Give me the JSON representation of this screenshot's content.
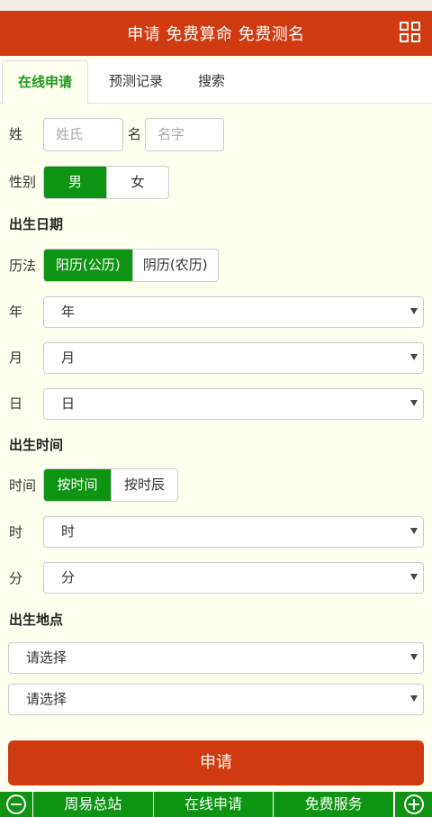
{
  "header": {
    "title": "申请 免费算命 免费测名"
  },
  "tabs": [
    {
      "label": "在线申请"
    },
    {
      "label": "预测记录"
    },
    {
      "label": "搜索"
    }
  ],
  "form": {
    "surname_label": "姓",
    "surname_placeholder": "姓氏",
    "name_label": "名",
    "name_placeholder": "名字",
    "gender_label": "性别",
    "gender_options": [
      "男",
      "女"
    ],
    "birth_date_section": "出生日期",
    "calendar_label": "历法",
    "calendar_options": [
      "阳历(公历)",
      "阴历(农历)"
    ],
    "year_label": "年",
    "year_value": "年",
    "month_label": "月",
    "month_value": "月",
    "day_label": "日",
    "day_value": "日",
    "birth_time_section": "出生时间",
    "time_label": "时间",
    "time_options": [
      "按时间",
      "按时辰"
    ],
    "hour_label": "时",
    "hour_value": "时",
    "minute_label": "分",
    "minute_value": "分",
    "birth_place_section": "出生地点",
    "province_value": "请选择",
    "city_value": "请选择",
    "submit_label": "申请"
  },
  "footer": {
    "items": [
      "周易总站",
      "在线申请",
      "免费服务"
    ]
  },
  "colors": {
    "brand_red": "#cf3a11",
    "brand_green": "#0e9412",
    "background": "#fffff0"
  }
}
